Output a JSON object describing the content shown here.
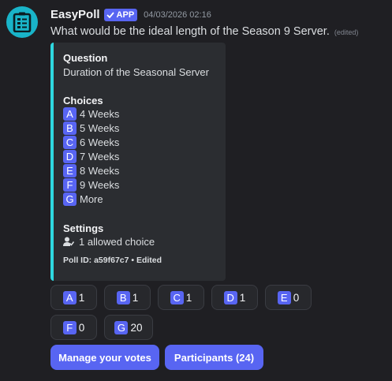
{
  "message": {
    "author": "EasyPoll",
    "badge": "APP",
    "timestamp": "04/03/2026 02:16",
    "text": "What would be the ideal length of the Season 9 Server.",
    "edited_label": "(edited)"
  },
  "embed": {
    "accent_color": "#2fd8e0",
    "question_title": "Question",
    "question_text": "Duration of the Seasonal Server",
    "choices_title": "Choices",
    "choices": [
      {
        "letter": "A",
        "label": "4 Weeks"
      },
      {
        "letter": "B",
        "label": "5 Weeks"
      },
      {
        "letter": "C",
        "label": "6 Weeks"
      },
      {
        "letter": "D",
        "label": "7 Weeks"
      },
      {
        "letter": "E",
        "label": "8 Weeks"
      },
      {
        "letter": "F",
        "label": "9 Weeks"
      },
      {
        "letter": "G",
        "label": "More"
      }
    ],
    "settings_title": "Settings",
    "setting_allowed": "1 allowed choice",
    "footer": "Poll ID: a59f67c7 • Edited"
  },
  "votes": [
    {
      "letter": "A",
      "count": "1"
    },
    {
      "letter": "B",
      "count": "1"
    },
    {
      "letter": "C",
      "count": "1"
    },
    {
      "letter": "D",
      "count": "1"
    },
    {
      "letter": "E",
      "count": "0"
    },
    {
      "letter": "F",
      "count": "0"
    },
    {
      "letter": "G",
      "count": "20"
    }
  ],
  "actions": {
    "manage_votes": "Manage your votes",
    "participants": "Participants (24)"
  },
  "colors": {
    "blurple": "#5865f2",
    "background": "#1f1f23",
    "embed_bg": "#2b2d31"
  },
  "icons": {
    "avatar": "poll-clipboard-icon",
    "badge": "checkmark-icon",
    "setting": "user-check-icon"
  }
}
